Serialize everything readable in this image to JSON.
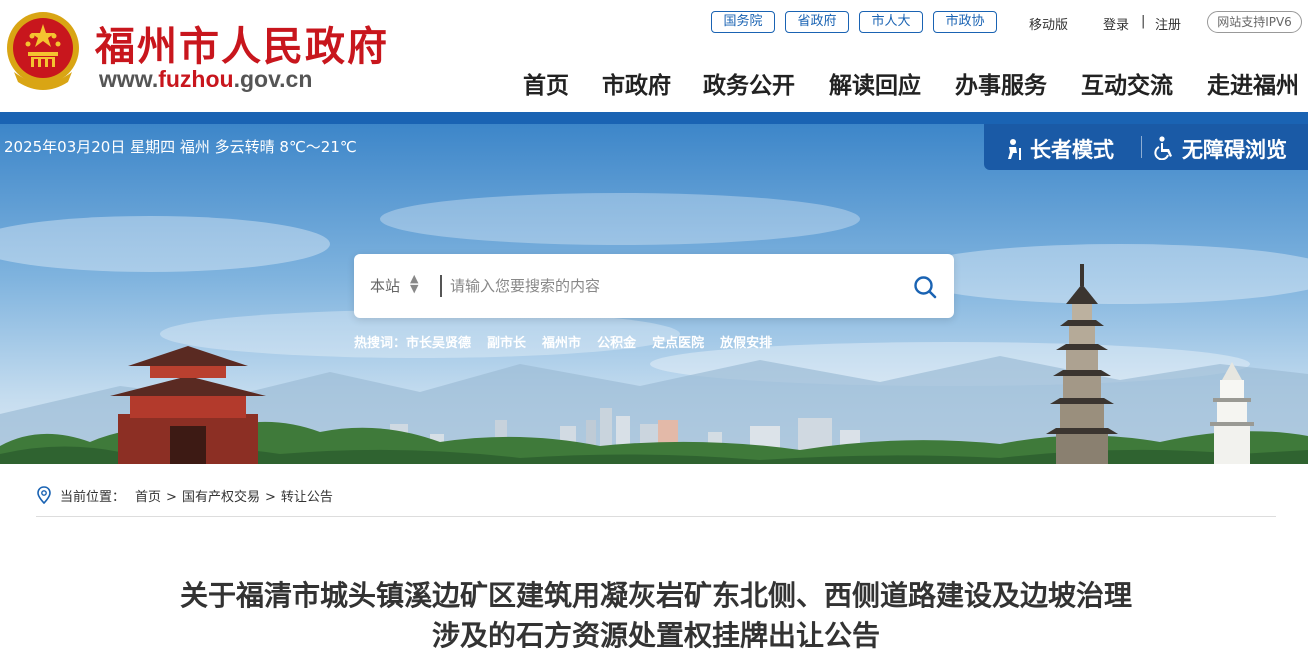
{
  "header": {
    "site_name": "福州市人民政府",
    "url_prefix": "www.",
    "url_highlight": "fuzhou",
    "url_suffix": ".gov.cn",
    "top_pills": [
      "国务院",
      "省政府",
      "市人大",
      "市政协"
    ],
    "mobile": "移动版",
    "login": "登录",
    "separator": "|",
    "register": "注册",
    "ipv6": "网站支持IPV6",
    "nav": [
      "首页",
      "市政府",
      "政务公开",
      "解读回应",
      "办事服务",
      "互动交流",
      "走进福州"
    ]
  },
  "banner": {
    "date_weather": "2025年03月20日 星期四  福州 多云转晴 8℃～21℃",
    "elder_mode": "长者模式",
    "accessible": "无障碍浏览",
    "search": {
      "scope": "本站",
      "placeholder": "请输入您要搜索的内容",
      "value": ""
    },
    "hot_label": "热搜词：",
    "hot_words": [
      "市长吴贤德",
      "副市长",
      "福州市",
      "公积金",
      "定点医院",
      "放假安排"
    ]
  },
  "breadcrumb": {
    "label": "当前位置：",
    "items": [
      "首页",
      "国有产权交易",
      "转让公告"
    ],
    "sep": ">"
  },
  "article": {
    "title_line1": "关于福清市城头镇溪边矿区建筑用凝灰岩矿东北侧、西侧道路建设及边坡治理",
    "title_line2": "涉及的石方资源处置权挂牌出让公告"
  },
  "colors": {
    "brand_red": "#c8161d",
    "primary_blue": "#1a63b3",
    "access_blue": "#1a5aa6"
  },
  "icons": {
    "emblem": "national-emblem",
    "elder": "elder-person-icon",
    "accessible": "wheelchair-icon",
    "search": "search-icon",
    "location": "location-pin-icon"
  }
}
